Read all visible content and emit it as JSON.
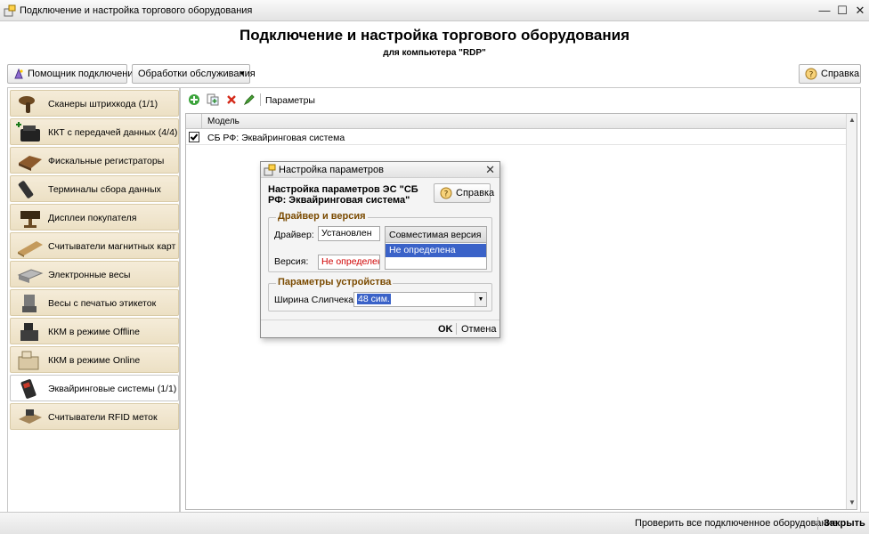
{
  "window": {
    "title": "Подключение и настройка торгового оборудования"
  },
  "header": {
    "title": "Подключение и настройка торгового оборудования",
    "subtitle": "для компьютера \"RDP\""
  },
  "toolbar": {
    "assistant_label": "Помощник подключения",
    "service_label": "Обработки обслуживания",
    "help_label": "Справка"
  },
  "categories": [
    {
      "label": "Сканеры штрихкода (1/1)",
      "icon": "barcode-scanner-icon"
    },
    {
      "label": "ККТ с передачей данных (4/4)",
      "icon": "cash-register-icon"
    },
    {
      "label": "Фискальные регистраторы",
      "icon": "fiscal-printer-icon"
    },
    {
      "label": "Терминалы сбора данных",
      "icon": "data-terminal-icon"
    },
    {
      "label": "Дисплеи покупателя",
      "icon": "customer-display-icon"
    },
    {
      "label": "Считыватели магнитных карт",
      "icon": "card-reader-icon"
    },
    {
      "label": "Электронные весы",
      "icon": "scale-icon"
    },
    {
      "label": "Весы с печатью этикеток",
      "icon": "label-scale-icon"
    },
    {
      "label": "ККМ в режиме Offline",
      "icon": "kkm-offline-icon"
    },
    {
      "label": "ККМ в режиме Online",
      "icon": "kkm-online-icon"
    },
    {
      "label": "Эквайринговые системы (1/1)",
      "icon": "pos-terminal-icon"
    },
    {
      "label": "Считыватели RFID меток",
      "icon": "rfid-reader-icon"
    }
  ],
  "active_category": "Эквайринговые системы (1/1)",
  "list": {
    "params_label": "Параметры",
    "column_model": "Модель",
    "rows": [
      {
        "checked": true,
        "model": "СБ РФ: Эквайринговая система"
      }
    ]
  },
  "dialog": {
    "title": "Настройка параметров",
    "heading": "Настройка параметров ЭС \"СБ РФ: Эквайринговая система\"",
    "help_label": "Справка",
    "group_driver": "Драйвер и версия",
    "driver_label": "Драйвер:",
    "driver_value": "Установлен",
    "version_label": "Версия:",
    "version_value": "Не определен",
    "compat_header": "Совместимая версия",
    "compat_value": "Не определена",
    "group_device": "Параметры устройства",
    "slip_label": "Ширина Слипчека:",
    "slip_value": "48 сим.",
    "ok_label": "OK",
    "cancel_label": "Отмена"
  },
  "footer": {
    "check_all_label": "Проверить все подключенное оборудование",
    "close_label": "Закрыть"
  },
  "colors": {
    "category_bg": "#f0e6cf",
    "selection_blue": "#3a62c8",
    "error_red": "#d00000",
    "legend_brown": "#7a4a00"
  }
}
